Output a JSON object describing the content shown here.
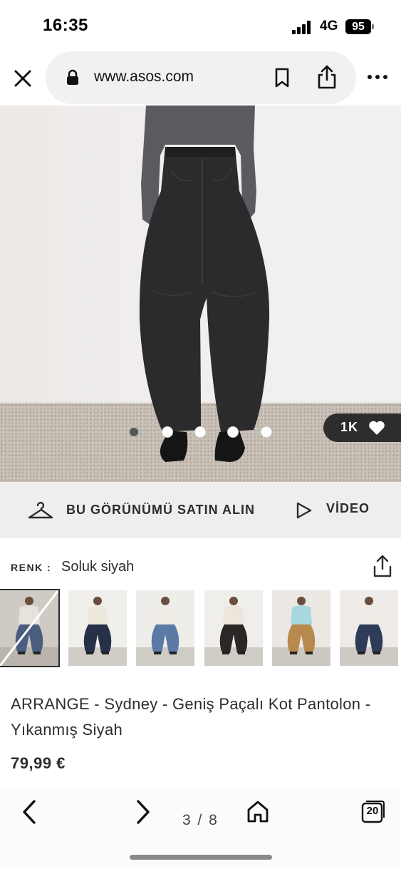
{
  "status_bar": {
    "time": "16:35",
    "network": "4G",
    "battery": "95"
  },
  "browser": {
    "url": "www.asos.com"
  },
  "gallery": {
    "likes": "1K",
    "total_slides": 5,
    "active_slide": 1
  },
  "actions": {
    "shop_the_look": "BU GÖRÜNÜMÜ SATIN ALIN",
    "video": "VİDEO"
  },
  "colour": {
    "label": "RENK :",
    "value": "Soluk siyah"
  },
  "swatches": [
    {
      "name": "swatch-light-blue",
      "jeans_color": "#4a5d7e",
      "top_color": "#e6e2dc",
      "bg": "#cfcac4",
      "selected": true,
      "sold_out": true
    },
    {
      "name": "swatch-dark-indigo",
      "jeans_color": "#263048",
      "top_color": "#efe8dc",
      "bg": "#f1efec",
      "selected": false,
      "sold_out": false
    },
    {
      "name": "swatch-mid-blue",
      "jeans_color": "#5b7aa6",
      "top_color": "#f0ece6",
      "bg": "#efedea",
      "selected": false,
      "sold_out": false
    },
    {
      "name": "swatch-black-coated",
      "jeans_color": "#2a2726",
      "top_color": "#ece6dd",
      "bg": "#efeeeb",
      "selected": false,
      "sold_out": false
    },
    {
      "name": "swatch-tan",
      "jeans_color": "#b8894e",
      "top_color": "#a9d8df",
      "bg": "#ebe8e4",
      "selected": false,
      "sold_out": false
    },
    {
      "name": "swatch-navy",
      "jeans_color": "#2e3c5a",
      "top_color": "#f1ede6",
      "bg": "#eeebe8",
      "selected": false,
      "sold_out": false
    }
  ],
  "product": {
    "title": "ARRANGE - Sydney - Geniş Paçalı Kot Pantolon - Yıkanmış Siyah",
    "price": "79,99 €"
  },
  "toolbar": {
    "page_counter": "3 / 8",
    "tabs_count": "20"
  },
  "colors": {
    "text": "#2d2d2d",
    "badge_bg": "#2d2d2d",
    "bar_bg": "#eeeeee"
  },
  "icons": [
    "close-icon",
    "lock-icon",
    "bookmark-icon",
    "share-icon",
    "more-icon",
    "heart-icon",
    "hanger-icon",
    "play-icon",
    "upload-icon",
    "chevron-left-icon",
    "chevron-right-icon",
    "home-icon",
    "tabs-icon"
  ]
}
